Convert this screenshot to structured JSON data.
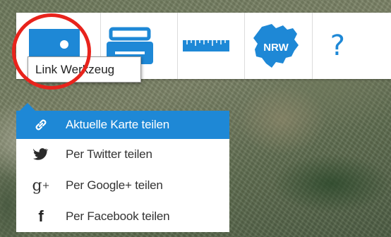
{
  "toolbar": {
    "tools": [
      {
        "id": "link",
        "icon": "share-link-icon"
      },
      {
        "id": "print",
        "icon": "print-icon"
      },
      {
        "id": "measure",
        "icon": "ruler-icon"
      },
      {
        "id": "nrw",
        "icon": "nrw-map-icon",
        "label": "NRW"
      },
      {
        "id": "help",
        "icon": "help-icon",
        "label": "?"
      }
    ],
    "tooltip": "Link Werkzeug"
  },
  "share_menu": {
    "items": [
      {
        "label": "Aktuelle Karte teilen",
        "icon": "chain-link-icon",
        "active": true
      },
      {
        "label": "Per Twitter teilen",
        "icon": "twitter-icon",
        "active": false
      },
      {
        "label": "Per Google+ teilen",
        "icon": "google-plus-icon",
        "active": false
      },
      {
        "label": "Per Facebook teilen",
        "icon": "facebook-icon",
        "active": false
      }
    ]
  },
  "colors": {
    "accent": "#1e88d6",
    "highlight": "#e8231c",
    "menu_background": "#ffffff"
  }
}
